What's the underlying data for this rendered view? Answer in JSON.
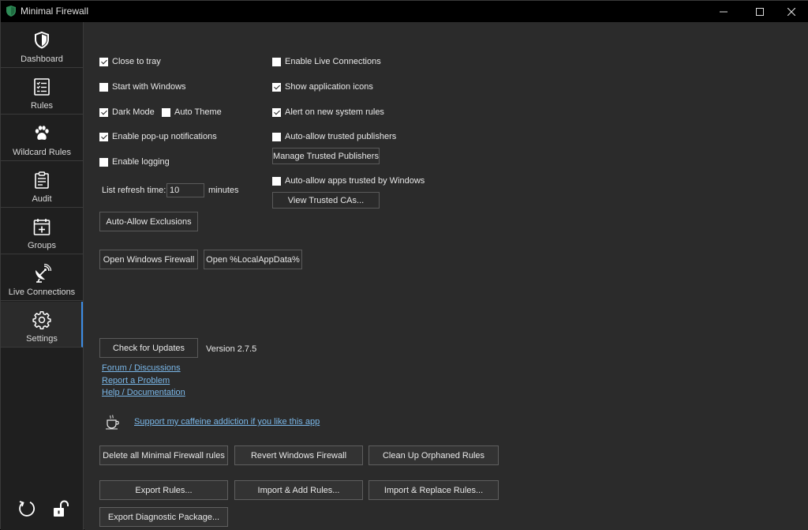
{
  "window": {
    "title": "Minimal Firewall",
    "controls": [
      "minimize-icon",
      "maximize-icon",
      "close-icon"
    ]
  },
  "sidebar": {
    "items": [
      {
        "label": "Dashboard",
        "icon": "shield-icon"
      },
      {
        "label": "Rules",
        "icon": "list-icon"
      },
      {
        "label": "Wildcard Rules",
        "icon": "paw-icon"
      },
      {
        "label": "Audit",
        "icon": "clipboard-icon"
      },
      {
        "label": "Groups",
        "icon": "calendar-plus-icon"
      },
      {
        "label": "Live Connections",
        "icon": "satellite-icon"
      },
      {
        "label": "Settings",
        "icon": "gear-icon",
        "active": true
      }
    ],
    "bottom_icons": [
      "refresh-icon",
      "unlock-icon"
    ]
  },
  "settings": {
    "left_checks": [
      {
        "label": "Close to tray",
        "checked": true
      },
      {
        "label": "Start with Windows",
        "checked": false
      },
      {
        "label": "Dark Mode",
        "checked": true
      },
      {
        "label": "Auto Theme",
        "checked": false
      },
      {
        "label": "Enable pop-up notifications",
        "checked": true
      },
      {
        "label": "Enable logging",
        "checked": false
      }
    ],
    "right_checks": [
      {
        "label": "Enable Live Connections",
        "checked": false
      },
      {
        "label": "Show application icons",
        "checked": true
      },
      {
        "label": "Alert on new system rules",
        "checked": true
      },
      {
        "label": "Auto-allow trusted publishers",
        "checked": false
      },
      {
        "label": "Auto-allow apps trusted by Windows",
        "checked": false
      }
    ],
    "refresh": {
      "label": "List refresh time:",
      "value": "10",
      "unit": "minutes"
    },
    "buttons": {
      "manage_publishers": "Manage Trusted Publishers",
      "view_cas": "View Trusted CAs...",
      "auto_allow_exclusions": "Auto-Allow Exclusions",
      "open_windows_firewall": "Open Windows Firewall",
      "open_localappdata": "Open %LocalAppData%",
      "check_updates": "Check for Updates",
      "delete_all": "Delete all Minimal Firewall rules",
      "revert": "Revert Windows Firewall",
      "cleanup": "Clean Up Orphaned Rules",
      "export_rules": "Export Rules...",
      "import_add": "Import & Add Rules...",
      "import_replace": "Import & Replace Rules...",
      "export_diag": "Export Diagnostic Package..."
    },
    "version": "Version 2.7.5",
    "links": {
      "forum": "Forum / Discussions",
      "report": "Report a Problem",
      "help": "Help / Documentation",
      "coffee": "Support my caffeine addiction if you like this app"
    }
  },
  "colors": {
    "background": "#2b2b2b",
    "sidebar": "#1f1f1f",
    "accent": "#3c8de6",
    "link": "#7ab7e8",
    "app_icon": "#2e8b57"
  }
}
